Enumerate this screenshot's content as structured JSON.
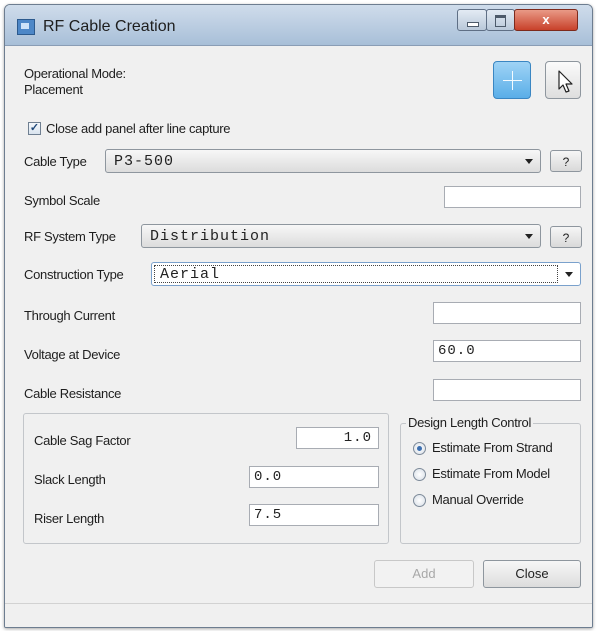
{
  "window": {
    "title": "RF Cable Creation",
    "close_glyph": "x"
  },
  "mode": {
    "label": "Operational Mode:",
    "value": "Placement"
  },
  "tools": [
    {
      "name": "crosshair-icon",
      "active": true
    },
    {
      "name": "pointer-arrow-icon",
      "active": false
    }
  ],
  "close_after_capture": {
    "label": "Close add panel after line capture",
    "checked": true,
    "check_glyph": "✓"
  },
  "cable_type": {
    "label": "Cable Type",
    "value": "P3-500",
    "help": "?"
  },
  "symbol_scale": {
    "label": "Symbol Scale",
    "value": ""
  },
  "rf_system_type": {
    "label": "RF System Type",
    "value": "Distribution",
    "help": "?"
  },
  "construction_type": {
    "label": "Construction Type",
    "value": "Aerial"
  },
  "through_current": {
    "label": "Through Current",
    "value": ""
  },
  "voltage_at_device": {
    "label": "Voltage at Device",
    "value": "60.0"
  },
  "cable_resistance": {
    "label": "Cable Resistance",
    "value": ""
  },
  "sag_group": {
    "cable_sag_factor": {
      "label": "Cable Sag Factor",
      "value": "1.0"
    },
    "slack_length": {
      "label": "Slack Length",
      "value": "0.0"
    },
    "riser_length": {
      "label": "Riser Length",
      "value": "7.5"
    }
  },
  "design_length_control": {
    "title": "Design Length Control",
    "options": [
      {
        "label": "Estimate From Strand",
        "selected": true
      },
      {
        "label": "Estimate From Model",
        "selected": false
      },
      {
        "label": "Manual Override",
        "selected": false
      }
    ]
  },
  "buttons": {
    "add": "Add",
    "add_enabled": false,
    "close": "Close"
  },
  "colors": {
    "accent": "#5aaee8",
    "close_button": "#c8412a"
  }
}
